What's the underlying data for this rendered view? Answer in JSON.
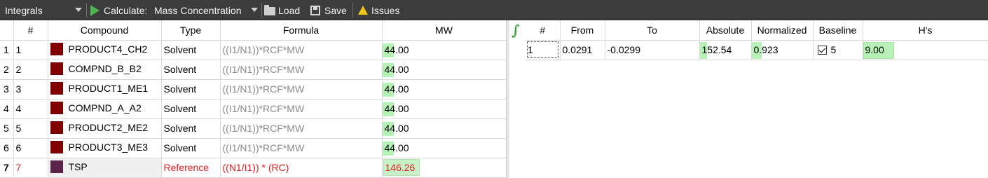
{
  "toolbar": {
    "view_selector": "Integrals",
    "calculate_label": "Calculate:",
    "calculate_mode": "Mass Concentration",
    "load_label": "Load",
    "save_label": "Save",
    "issues_label": "Issues"
  },
  "compounds_table": {
    "headers": [
      "#",
      "Compound",
      "Type",
      "Formula",
      "MW"
    ],
    "rows": [
      {
        "row": "1",
        "num": "1",
        "compound": "PRODUCT4_CH2",
        "type": "Solvent",
        "formula": "((I1/N1))*RCF*MW",
        "mw": "44.00",
        "color": "#800000"
      },
      {
        "row": "2",
        "num": "2",
        "compound": "COMPND_B_B2",
        "type": "Solvent",
        "formula": "((I1/N1))*RCF*MW",
        "mw": "44.00",
        "color": "#800000"
      },
      {
        "row": "3",
        "num": "3",
        "compound": "PRODUCT1_ME1",
        "type": "Solvent",
        "formula": "((I1/N1))*RCF*MW",
        "mw": "44.00",
        "color": "#800000"
      },
      {
        "row": "4",
        "num": "4",
        "compound": "COMPND_A_A2",
        "type": "Solvent",
        "formula": "((I1/N1))*RCF*MW",
        "mw": "44.00",
        "color": "#800000"
      },
      {
        "row": "5",
        "num": "5",
        "compound": "PRODUCT2_ME2",
        "type": "Solvent",
        "formula": "((I1/N1))*RCF*MW",
        "mw": "44.00",
        "color": "#800000"
      },
      {
        "row": "6",
        "num": "6",
        "compound": "PRODUCT3_ME3",
        "type": "Solvent",
        "formula": "((I1/N1))*RCF*MW",
        "mw": "44.00",
        "color": "#800000"
      },
      {
        "row": "7",
        "num": "7",
        "compound": "TSP",
        "type": "Reference",
        "formula": "((N1/I1)) * (RC)",
        "mw": "146.26",
        "color": "#5a2448"
      }
    ]
  },
  "integrals_table": {
    "headers": [
      "#",
      "From",
      "To",
      "Absolute",
      "Normalized",
      "Baseline",
      "H's"
    ],
    "rows": [
      {
        "num": "1",
        "from": "0.0291",
        "to": "-0.0299",
        "absolute": "152.54",
        "normalized": "0.923",
        "baseline": "5",
        "hs": "9.00"
      }
    ]
  },
  "colors": {
    "toolbar_bg": "#3c3c3c",
    "mw_highlight": "#b6f2b6",
    "reference_text": "#e02020",
    "integral_icon": "#2fa12f"
  },
  "icons": [
    "chevron-down-icon",
    "play-icon",
    "folder-icon",
    "save-icon",
    "warning-icon",
    "integral-icon",
    "checkbox-checked-icon"
  ]
}
